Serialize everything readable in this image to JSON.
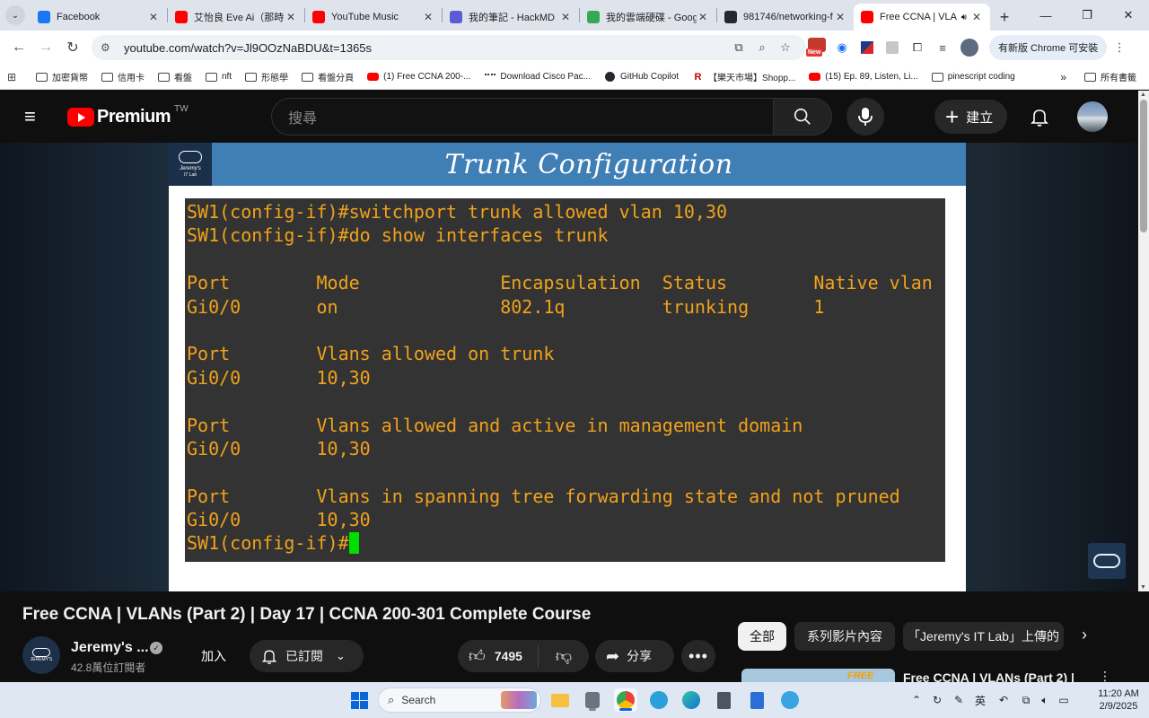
{
  "browser": {
    "tabs": [
      {
        "title": "Facebook",
        "favicon": "facebook-icon",
        "color": "#1877f2"
      },
      {
        "title": "艾怡良 Eve Ai（那時",
        "favicon": "youtube-icon",
        "color": "#ff0000"
      },
      {
        "title": "YouTube Music",
        "favicon": "youtube-music-icon",
        "color": "#ff0000"
      },
      {
        "title": "我的筆記 - HackMD",
        "favicon": "hackmd-icon",
        "color": "#5b5bd6"
      },
      {
        "title": "我的雲端硬碟 - Goog",
        "favicon": "google-drive-icon",
        "color": "#34a853"
      },
      {
        "title": "981746/networking-f",
        "favicon": "github-icon",
        "color": "#24292f"
      },
      {
        "title": "Free CCNA | VLA",
        "favicon": "youtube-icon",
        "color": "#ff0000",
        "active": true
      }
    ],
    "url": "youtube.com/watch?v=Jl9OOzNaBDU&t=1365s",
    "update_button": "有新版 Chrome 可安裝",
    "new_badge": "New",
    "bookmarks": [
      {
        "label": "加密貨幣",
        "icon": "folder-icon"
      },
      {
        "label": "信用卡",
        "icon": "folder-icon"
      },
      {
        "label": "看盤",
        "icon": "folder-icon"
      },
      {
        "label": "nft",
        "icon": "folder-icon"
      },
      {
        "label": "形態學",
        "icon": "folder-icon"
      },
      {
        "label": "看盤分頁",
        "icon": "folder-icon"
      },
      {
        "label": "(1) Free CCNA 200-...",
        "icon": "youtube-icon"
      },
      {
        "label": "Download Cisco Pac...",
        "icon": "cisco-icon"
      },
      {
        "label": "GitHub Copilot",
        "icon": "github-icon"
      },
      {
        "label": "【樂天市場】Shopp...",
        "icon": "rakuten-icon"
      },
      {
        "label": "(15) Ep. 89, Listen, Li...",
        "icon": "youtube-icon"
      },
      {
        "label": "pinescript coding",
        "icon": "folder-icon"
      }
    ],
    "bookmarks_overflow": "»",
    "all_bookmarks": "所有書籤"
  },
  "youtube": {
    "logo_text": "Premium",
    "region": "TW",
    "search_placeholder": "搜尋",
    "create_label": "建立"
  },
  "slide": {
    "logo_line1": "Jeremy's",
    "logo_line2": "IT Lab",
    "title": "Trunk Configuration",
    "terminal_lines": [
      "SW1(config-if)#switchport trunk allowed vlan 10,30",
      "SW1(config-if)#do show interfaces trunk",
      "",
      "Port        Mode             Encapsulation  Status        Native vlan",
      "Gi0/0       on               802.1q         trunking      1",
      "",
      "Port        Vlans allowed on trunk",
      "Gi0/0       10,30",
      "",
      "Port        Vlans allowed and active in management domain",
      "Gi0/0       10,30",
      "",
      "Port        Vlans in spanning tree forwarding state and not pruned",
      "Gi0/0       10,30"
    ],
    "prompt": "SW1(config-if)#"
  },
  "video": {
    "title": "Free CCNA | VLANs (Part 2) | Day 17 | CCNA 200-301 Complete Course",
    "channel_name": "Jeremy's ...",
    "channel_avatar_text": "JEREMY'S",
    "subscribers": "42.8萬位訂閱者",
    "join_label": "加入",
    "subscribed_label": "已訂閱",
    "like_count": "7495",
    "share_label": "分享"
  },
  "sidebar": {
    "chips": [
      "全部",
      "系列影片內容",
      "「Jeremy's IT Lab」上傳的"
    ],
    "rec_title": "Free CCNA | VLANs (Part 2) |",
    "rec_badge": "FREE"
  },
  "taskbar": {
    "search_label": "Search",
    "ime_label": "英",
    "time": "11:20 AM",
    "date": "2/9/2025"
  }
}
